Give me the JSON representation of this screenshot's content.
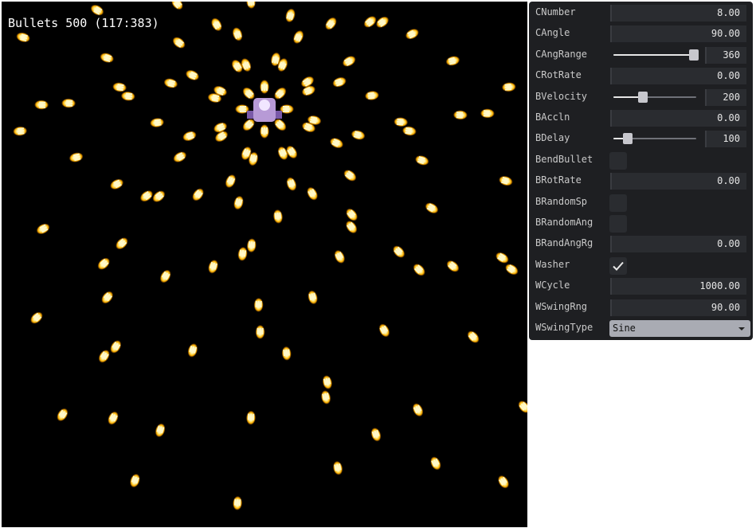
{
  "game": {
    "hud_text": "Bullets 500 (117:383)",
    "colors": {
      "background": "#000000",
      "bullet_core": "#fffbe0",
      "bullet_glow": "#ffb000",
      "player": "#b79ad6"
    }
  },
  "panel": {
    "rows": [
      {
        "id": "cnumber",
        "label": "CNumber",
        "type": "number",
        "value": "8.00"
      },
      {
        "id": "cangle",
        "label": "CAngle",
        "type": "number",
        "value": "90.00"
      },
      {
        "id": "cangrange",
        "label": "CAngRange",
        "type": "slider",
        "value": "360",
        "fraction": 0.97
      },
      {
        "id": "crotrate",
        "label": "CRotRate",
        "type": "number",
        "value": "0.00"
      },
      {
        "id": "bvelocity",
        "label": "BVelocity",
        "type": "slider",
        "value": "200",
        "fraction": 0.36
      },
      {
        "id": "baccln",
        "label": "BAccln",
        "type": "number",
        "value": "0.00"
      },
      {
        "id": "bdelay",
        "label": "BDelay",
        "type": "slider",
        "value": "100",
        "fraction": 0.17
      },
      {
        "id": "bendbullet",
        "label": "BendBullet",
        "type": "checkbox",
        "checked": false
      },
      {
        "id": "brotrate",
        "label": "BRotRate",
        "type": "number",
        "value": "0.00"
      },
      {
        "id": "brandomsp",
        "label": "BRandomSp",
        "type": "checkbox",
        "checked": false
      },
      {
        "id": "brandomang",
        "label": "BRandomAng",
        "type": "checkbox",
        "checked": false
      },
      {
        "id": "brandangrg",
        "label": "BRandAngRg",
        "type": "number",
        "value": "0.00"
      },
      {
        "id": "washer",
        "label": "Washer",
        "type": "checkbox",
        "checked": true
      },
      {
        "id": "wcycle",
        "label": "WCycle",
        "type": "number",
        "value": "1000.00"
      },
      {
        "id": "wswingrng",
        "label": "WSwingRng",
        "type": "number",
        "value": "90.00"
      },
      {
        "id": "wswingtype",
        "label": "WSwingType",
        "type": "select",
        "value": "Sine"
      }
    ]
  }
}
